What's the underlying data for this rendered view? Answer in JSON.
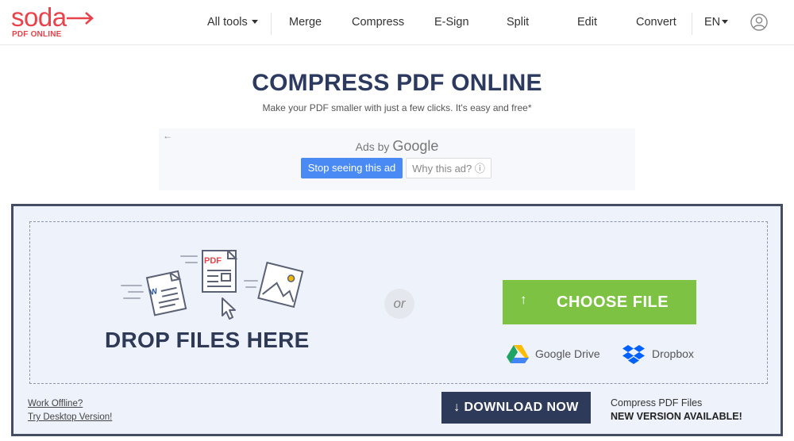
{
  "brand": {
    "name": "soda",
    "sub": "PDF ONLINE",
    "color": "#e8434a"
  },
  "nav": {
    "all_tools": "All tools",
    "merge": "Merge",
    "compress": "Compress",
    "esign": "E-Sign",
    "split": "Split",
    "edit": "Edit",
    "convert": "Convert",
    "language": "EN"
  },
  "page": {
    "title": "COMPRESS PDF ONLINE",
    "subtitle": "Make your PDF smaller with just a few clicks. It's easy and free*"
  },
  "ad": {
    "ads_by": "Ads by",
    "google": "Google",
    "stop_label": "Stop seeing this ad",
    "why_label": "Why this ad? ⓘ"
  },
  "upload": {
    "drop_label": "DROP FILES HERE",
    "or_label": "or",
    "choose_label": "CHOOSE FILE",
    "google_drive": "Google Drive",
    "dropbox": "Dropbox",
    "pdf_badge": "PDF",
    "word_badge": "W"
  },
  "footer": {
    "work_offline": "Work Offline?",
    "desktop_version": "Try Desktop Version!",
    "download_label": "↓ DOWNLOAD NOW",
    "compress_files": "Compress PDF Files",
    "new_version": "NEW VERSION AVAILABLE!"
  },
  "colors": {
    "accent_green": "#7dc242",
    "navy": "#2e3a59",
    "ad_blue": "#4a8af4"
  }
}
